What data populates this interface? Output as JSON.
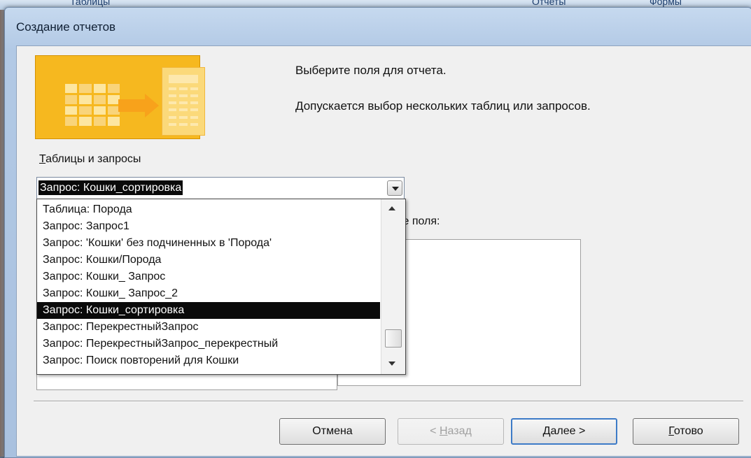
{
  "dialog": {
    "title": "Создание отчетов",
    "intro_line1": "Выберите поля для отчета.",
    "intro_line2": "Допускается выбор нескольких таблиц или запросов."
  },
  "tables_label": "Таблицы и запросы",
  "combo": {
    "selected": "Запрос: Кошки_сортировка"
  },
  "dropdown": {
    "items": [
      "Таблица: Порода",
      "Запрос: Запрос1",
      "Запрос: 'Кошки' без подчиненных в 'Порода'",
      "Запрос: Кошки/Порода",
      "Запрос: Кошки_ Запрос",
      "Запрос: Кошки_ Запрос_2",
      "Запрос: Кошки_сортировка",
      "Запрос: ПерекрестныйЗапрос",
      "Запрос: ПерекрестныйЗапрос_перекрестный",
      "Запрос: Поиск повторений для Кошки"
    ],
    "selected_index": 6
  },
  "selected_fields_label": "ые поля:",
  "buttons": {
    "cancel": "Отмена",
    "back": "< Назад",
    "next": "Далее >",
    "finish": "Готово"
  },
  "background": {
    "left_text": "Таблицы",
    "mid_text": "Отчеты",
    "right_text": "Формы"
  }
}
